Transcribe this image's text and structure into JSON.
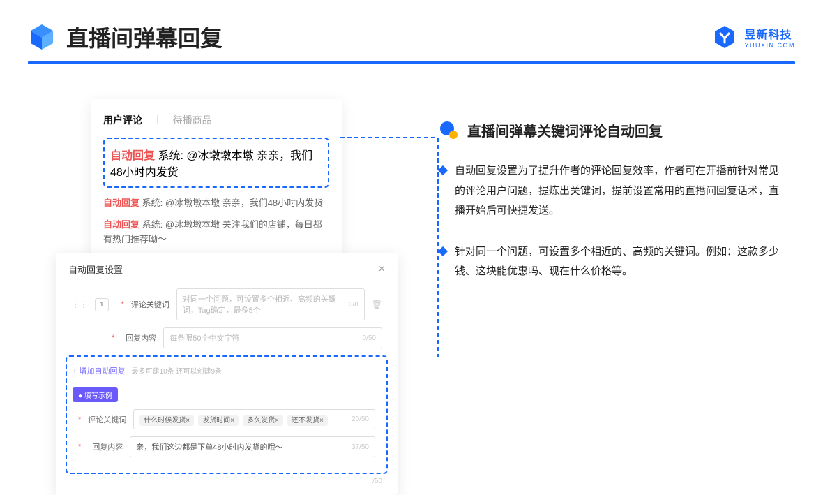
{
  "header": {
    "title": "直播间弹幕回复",
    "brand_cn": "昱新科技",
    "brand_en": "YUUXIN.COM"
  },
  "section": {
    "title": "直播间弹幕关键词评论自动回复",
    "bullet1": "自动回复设置为了提升作者的评论回复效率，作者可在开播前针对常见的评论用户问题，提炼出关键词，提前设置常用的直播间回复话术，直播开始后可快捷发送。",
    "bullet2": "针对同一个问题，可设置多个相近的、高频的关键词。例如：这款多少钱、这块能优惠吗、现在什么价格等。"
  },
  "comments": {
    "tab1": "用户评论",
    "tab2": "待播商品",
    "auto_tag": "自动回复",
    "sys_pre": "系统:",
    "c1": "@冰墩墩本墩 亲亲，我们48小时内发货",
    "c2": "@冰墩墩本墩 亲亲，我们48小时内发货",
    "c3": "@冰墩墩本墩 关注我们的店铺，每日都有热门推荐呦～"
  },
  "settings": {
    "title": "自动回复设置",
    "num": "1",
    "label_keyword": "评论关键词",
    "ph_keyword": "对同一个问题，可设置多个相近、高频的关键词，Tag确定，最多5个",
    "count_keyword": "0/8",
    "label_content": "回复内容",
    "ph_content": "每条限50个中文字符",
    "count_content": "0/50",
    "add_text": "+ 增加自动回复",
    "add_hint": "最多可建10条 还可以创建9条",
    "example_badge": "● 填写示例",
    "ex_label_kw": "评论关键词",
    "tag1": "什么时候发货×",
    "tag2": "发货时间×",
    "tag3": "多久发货×",
    "tag4": "还不发货×",
    "ex_count_kw": "20/50",
    "ex_label_ct": "回复内容",
    "ex_content": "亲，我们这边都是下单48小时内发货的哦～",
    "ex_count_ct": "37/50",
    "outer_count": "/50"
  }
}
